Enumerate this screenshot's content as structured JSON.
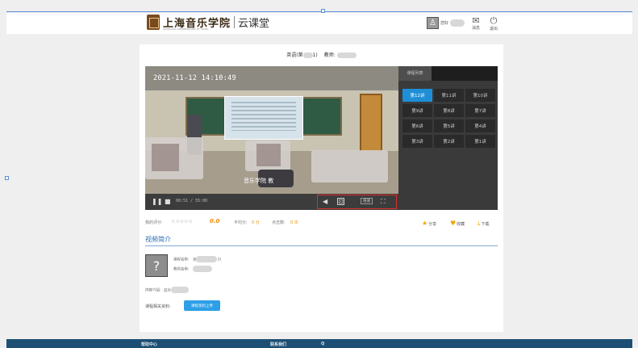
{
  "header": {
    "school_name": "上海音乐学院",
    "school_sub": "SHANGHAI CONSERVATORY OF MUSIC",
    "app_name": "云课堂",
    "user_prefix": "您好",
    "messages_label": "消息",
    "logout_label": "退出"
  },
  "course": {
    "title_prefix": "英语(第",
    "title_suffix": "1)",
    "teacher_prefix": "教师:"
  },
  "player": {
    "timestamp": "2021-11-12  14:10:49",
    "subtitle": "音乐学院 教",
    "time_display": "00:51 / 55:00",
    "rate_label": "倍速"
  },
  "episodes": {
    "tab_label": "课程列表",
    "items": [
      {
        "label": "第12讲",
        "active": true
      },
      {
        "label": "第11讲",
        "active": false
      },
      {
        "label": "第10讲",
        "active": false
      },
      {
        "label": "第9讲",
        "active": false
      },
      {
        "label": "第8讲",
        "active": false
      },
      {
        "label": "第7讲",
        "active": false
      },
      {
        "label": "第6讲",
        "active": false
      },
      {
        "label": "第5讲",
        "active": false
      },
      {
        "label": "第4讲",
        "active": false
      },
      {
        "label": "第3讲",
        "active": false
      },
      {
        "label": "第2讲",
        "active": false
      },
      {
        "label": "第1讲",
        "active": false
      }
    ]
  },
  "rating": {
    "label": "我的评分:",
    "stars": "☆☆☆☆☆",
    "score": "0.0",
    "avg_label": "平均分:",
    "avg_value": "0 分",
    "count_label": "点击数:",
    "count_value": "0 次",
    "share_label": "分享",
    "favorite_label": "收藏",
    "download_label": "下载"
  },
  "intro": {
    "section_title": "视频简介",
    "course_name_label": "课程名称:",
    "course_name_value": "英",
    "course_name_suffix": "3)",
    "teacher_name_label": "教师名称:",
    "content_label": "内容介绍:",
    "content_value": "前外",
    "material_label": "课程相关资料:",
    "upload_button": "课程资料上传"
  },
  "footer": {
    "help_label": "帮助中心",
    "contact_label": "联系我们",
    "extra": "Q"
  }
}
